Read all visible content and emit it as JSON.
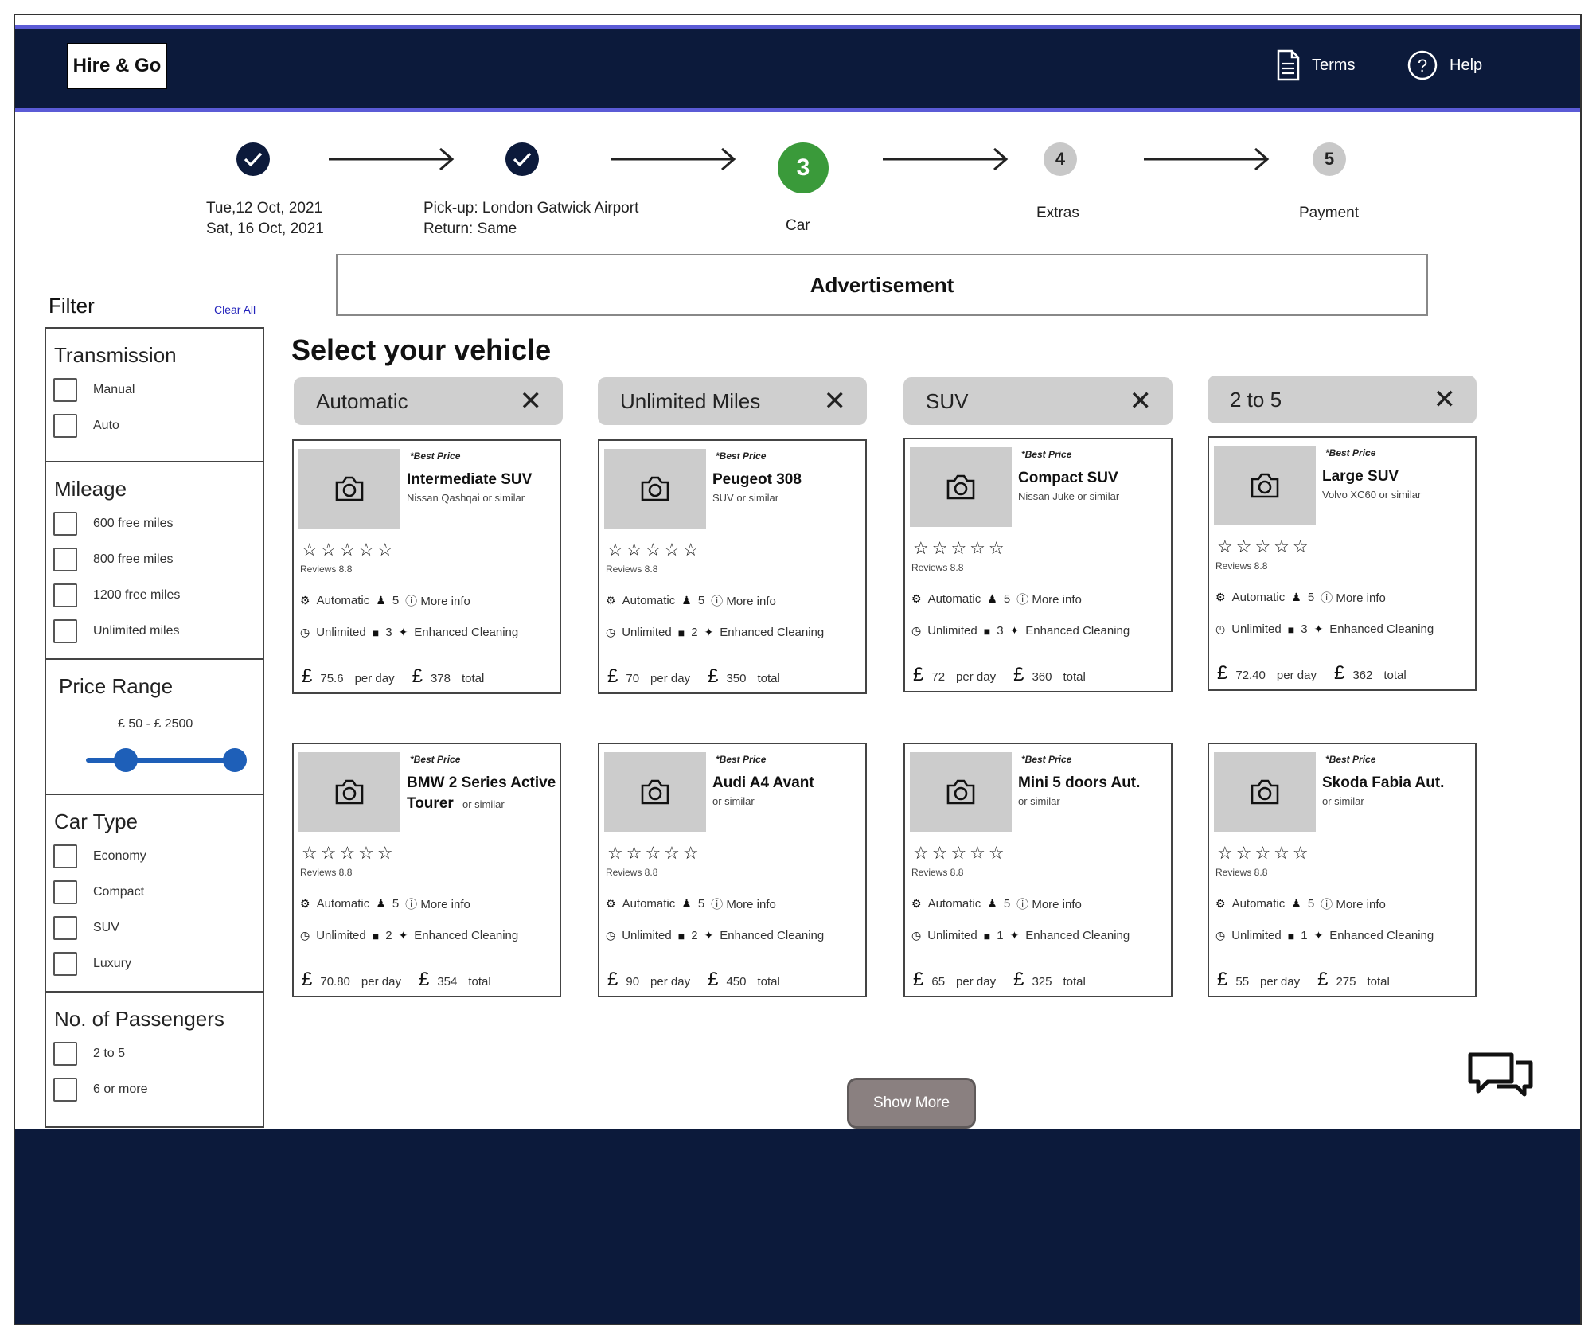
{
  "header": {
    "logo": "Hire & Go",
    "terms_label": "Terms",
    "help_label": "Help"
  },
  "stepper": {
    "step1_line1": "Tue,12 Oct, 2021",
    "step1_line2": "Sat, 16 Oct, 2021",
    "step2_line1": "Pick-up: London Gatwick Airport",
    "step2_line2": "Return: Same",
    "step3_number": "3",
    "step3_label": "Car",
    "step4_number": "4",
    "step4_label": "Extras",
    "step5_number": "5",
    "step5_label": "Payment"
  },
  "advertisement": "Advertisement",
  "filter": {
    "title": "Filter",
    "clear_all": "Clear All",
    "transmission": {
      "title": "Transmission",
      "options": [
        "Manual",
        "Auto"
      ]
    },
    "mileage": {
      "title": "Mileage",
      "options": [
        "600 free miles",
        "800 free miles",
        "1200 free miles",
        "Unlimited miles"
      ]
    },
    "price_range": {
      "title": "Price Range",
      "label": "£ 50 - £ 2500"
    },
    "car_type": {
      "title": "Car Type",
      "options": [
        "Economy",
        "Compact",
        "SUV",
        "Luxury"
      ]
    },
    "passengers": {
      "title": "No. of Passengers",
      "options": [
        "2 to 5",
        "6 or more"
      ]
    }
  },
  "main": {
    "title": "Select your vehicle",
    "chips": [
      "Automatic",
      "Unlimited Miles",
      "SUV",
      "2 to 5"
    ],
    "show_more": "Show More"
  },
  "cards": [
    {
      "best": "*Best Price",
      "name": "Intermediate SUV",
      "similar": "Nissan Qashqai or similar",
      "reviews": "Reviews 8.8",
      "transmission": "Automatic",
      "seats": "5",
      "more_info": "More info",
      "mileage": "Unlimited",
      "bags": "3",
      "cleaning": "Enhanced Cleaning",
      "per_day": "75.6",
      "per_day_label": "per day",
      "total": "378",
      "total_label": "total",
      "rating": 5
    },
    {
      "best": "*Best Price",
      "name": "Peugeot 308",
      "similar": "SUV or similar",
      "reviews": "Reviews 8.8",
      "transmission": "Automatic",
      "seats": "5",
      "more_info": "More info",
      "mileage": "Unlimited",
      "bags": "2",
      "cleaning": "Enhanced Cleaning",
      "per_day": "70",
      "per_day_label": "per day",
      "total": "350",
      "total_label": "total",
      "rating": 5
    },
    {
      "best": "*Best Price",
      "name": "Compact SUV",
      "similar": "Nissan Juke or similar",
      "reviews": "Reviews 8.8",
      "transmission": "Automatic",
      "seats": "5",
      "more_info": "More info",
      "mileage": "Unlimited",
      "bags": "3",
      "cleaning": "Enhanced Cleaning",
      "per_day": "72",
      "per_day_label": "per day",
      "total": "360",
      "total_label": "total",
      "rating": 5
    },
    {
      "best": "*Best Price",
      "name": "Large SUV",
      "similar": "Volvo XC60 or similar",
      "reviews": "Reviews 8.8",
      "transmission": "Automatic",
      "seats": "5",
      "more_info": "More info",
      "mileage": "Unlimited",
      "bags": "3",
      "cleaning": "Enhanced Cleaning",
      "per_day": "72.40",
      "per_day_label": "per day",
      "total": "362",
      "total_label": "total",
      "rating": 5
    },
    {
      "best": "*Best Price",
      "name": "BMW 2 Series Active Tourer",
      "similar": "or similar",
      "reviews": "Reviews 8.8",
      "transmission": "Automatic",
      "seats": "5",
      "more_info": "More info",
      "mileage": "Unlimited",
      "bags": "2",
      "cleaning": "Enhanced Cleaning",
      "per_day": "70.80",
      "per_day_label": "per day",
      "total": "354",
      "total_label": "total",
      "rating": 5
    },
    {
      "best": "*Best Price",
      "name": "Audi A4 Avant",
      "similar": "or similar",
      "reviews": "Reviews 8.8",
      "transmission": "Automatic",
      "seats": "5",
      "more_info": "More info",
      "mileage": "Unlimited",
      "bags": "2",
      "cleaning": "Enhanced Cleaning",
      "per_day": "90",
      "per_day_label": "per day",
      "total": "450",
      "total_label": "total",
      "rating": 5
    },
    {
      "best": "*Best Price",
      "name": "Mini 5 doors Aut.",
      "similar": "or similar",
      "reviews": "Reviews 8.8",
      "transmission": "Automatic",
      "seats": "5",
      "more_info": "More info",
      "mileage": "Unlimited",
      "bags": "1",
      "cleaning": "Enhanced Cleaning",
      "per_day": "65",
      "per_day_label": "per day",
      "total": "325",
      "total_label": "total",
      "rating": 5
    },
    {
      "best": "*Best Price",
      "name": "Skoda Fabia Aut.",
      "similar": "or similar",
      "reviews": "Reviews 8.8",
      "transmission": "Automatic",
      "seats": "5",
      "more_info": "More info",
      "mileage": "Unlimited",
      "bags": "1",
      "cleaning": "Enhanced Cleaning",
      "per_day": "55",
      "per_day_label": "per day",
      "total": "275",
      "total_label": "total",
      "rating": 5
    }
  ],
  "colors": {
    "header_bg": "#0c1a3b",
    "header_border": "#5b5bd6",
    "active_step": "#3a9a3a",
    "slider": "#1e5fb8",
    "chip_bg": "#cfcfcf",
    "show_more_bg": "#8a8080"
  },
  "icons": {
    "terms": "document-icon",
    "help": "question-circle-icon",
    "step_done": "check-icon",
    "card_photo": "camera-icon",
    "chip_close": "close-icon",
    "chat": "chat-bubbles-icon"
  }
}
